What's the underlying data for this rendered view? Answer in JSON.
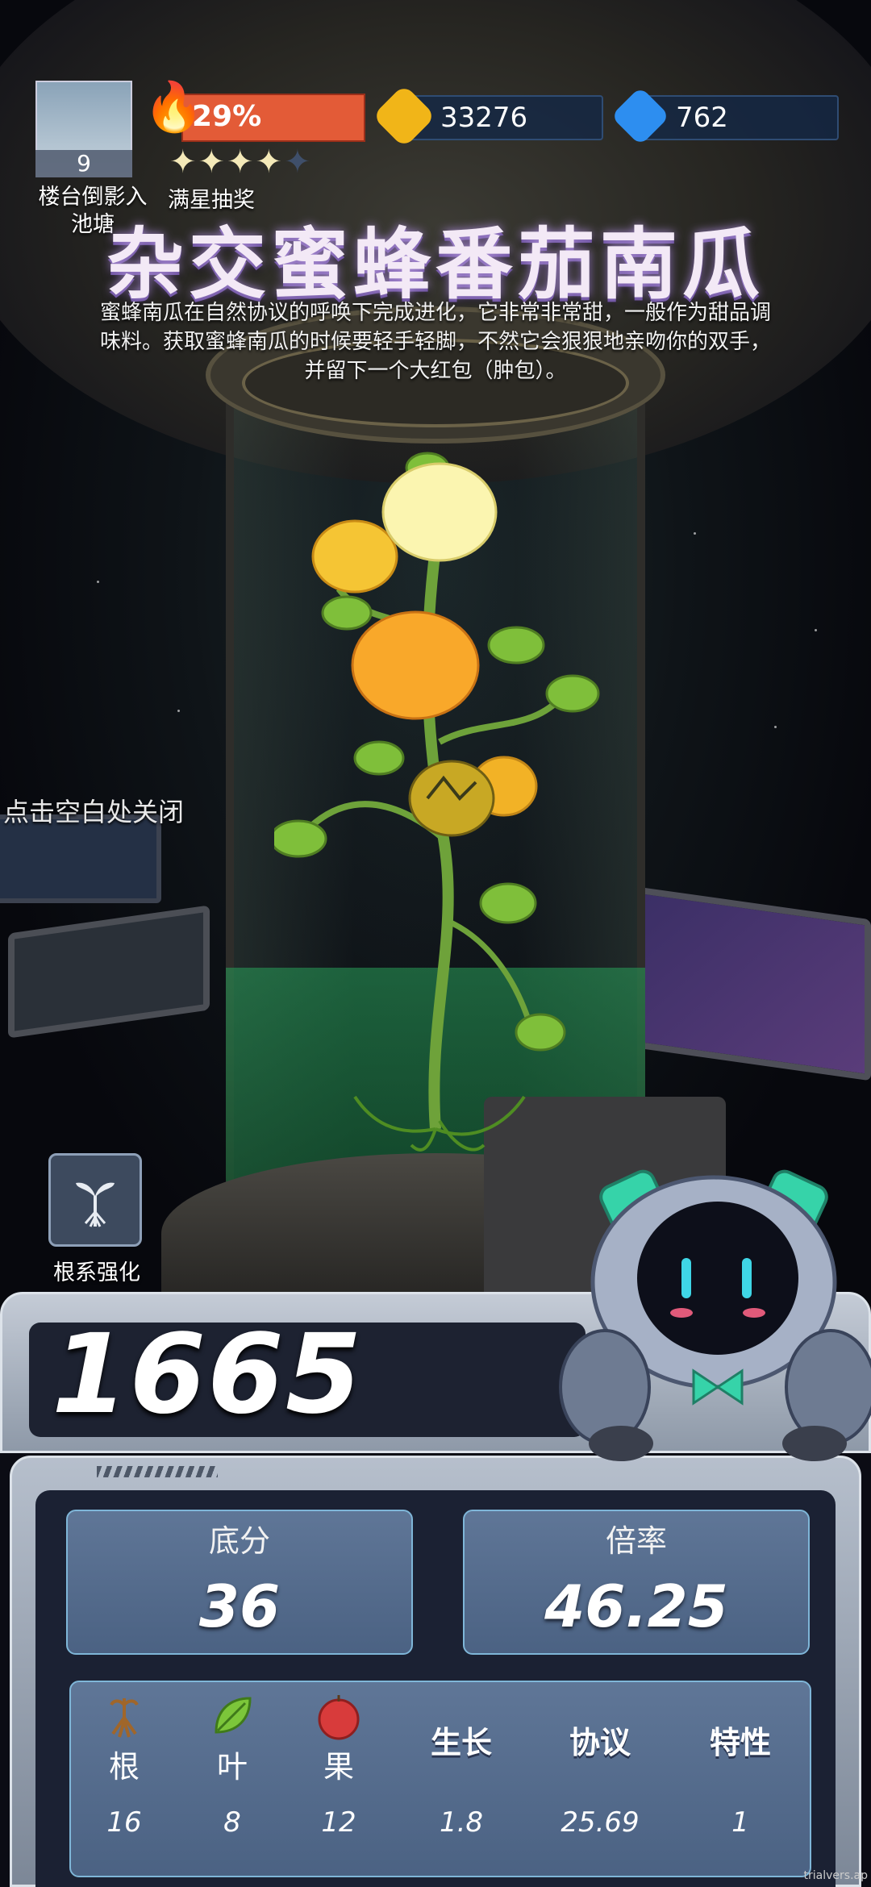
{
  "hud": {
    "thumbnail_count": "9",
    "thumbnail_label_line1": "楼台倒影入",
    "thumbnail_label_line2": "池塘",
    "fire_percent": "29%",
    "stars_filled": 4,
    "stars_total": 5,
    "lottery_label": "满星抽奖",
    "coins": "33276",
    "gems": "762"
  },
  "plant": {
    "name": "杂交蜜蜂番茄南瓜",
    "description_line1": "蜜蜂南瓜在自然协议的呼唤下完成进化，它非常非常甜，一般作为甜品调",
    "description_line2": "味料。获取蜜蜂南瓜的时候要轻手轻脚，不然它会狠狠地亲吻你的双手，",
    "description_line3": "并留下一个大红包（肿包）。"
  },
  "close_hint": "点击空白处关闭",
  "root_boost_label": "根系强化",
  "score": "1665",
  "base": {
    "label": "底分",
    "value": "36"
  },
  "multiplier": {
    "label": "倍率",
    "value": "46.25"
  },
  "attributes": [
    {
      "label": "根",
      "value": "16",
      "icon": "root-icon"
    },
    {
      "label": "叶",
      "value": "8",
      "icon": "leaf-icon"
    },
    {
      "label": "果",
      "value": "12",
      "icon": "fruit-icon"
    },
    {
      "label": "生长",
      "value": "1.8"
    },
    {
      "label": "协议",
      "value": "25.69"
    },
    {
      "label": "特性",
      "value": "1"
    }
  ],
  "watermark": "trialvers.ap",
  "colors": {
    "accent_fire": "#e35b37",
    "panel_card": "#5f7697",
    "liquid": "#28a05a"
  }
}
